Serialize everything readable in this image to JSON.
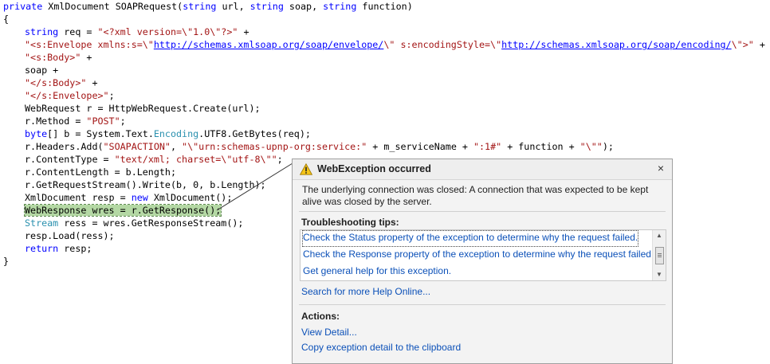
{
  "code": {
    "l1": {
      "k1": "private",
      "t1": " XmlDocument SOAPRequest(",
      "k2": "string",
      "t2": " url, ",
      "k3": "string",
      "t3": " soap, ",
      "k4": "string",
      "t4": " function)"
    },
    "l2": "{",
    "l3": {
      "k1": "string",
      "t1": " req = ",
      "s1": "\"<?xml version=\\\"1.0\\\"?>\"",
      "t2": " +"
    },
    "l4": {
      "s1": "\"<s:Envelope xmlns:s=\\\"",
      "u1": "http://schemas.xmlsoap.org/soap/envelope/",
      "s2": "\\\" s:encodingStyle=\\\"",
      "u2": "http://schemas.xmlsoap.org/soap/encoding/",
      "s3": "\\\">\"",
      "t1": " +"
    },
    "l5": {
      "s1": "\"<s:Body>\"",
      "t1": " +"
    },
    "l6": "soap +",
    "l7": {
      "s1": "\"</s:Body>\"",
      "t1": " +"
    },
    "l8": {
      "s1": "\"</s:Envelope>\"",
      "t1": ";"
    },
    "l9": "WebRequest r = HttpWebRequest.Create(url);",
    "l10": {
      "t1": "r.Method = ",
      "s1": "\"POST\"",
      "t2": ";"
    },
    "l11": {
      "k1": "byte",
      "t1": "[] b = System.Text.",
      "c1": "Encoding",
      "t2": ".UTF8.GetBytes(req);"
    },
    "l12": {
      "t1": "r.Headers.Add(",
      "s1": "\"SOAPACTION\"",
      "t2": ", ",
      "s2": "\"\\\"urn:schemas-upnp-org:service:\"",
      "t3": " + m_serviceName + ",
      "s3": "\":1#\"",
      "t4": " + function + ",
      "s4": "\"\\\"\"",
      "t5": ");"
    },
    "l13": {
      "t1": "r.ContentType = ",
      "s1": "\"text/xml; charset=\\\"utf-8\\\"\"",
      "t2": ";"
    },
    "l14": "r.ContentLength = b.Length;",
    "l15": "r.GetRequestStream().Write(b, 0, b.Length);",
    "l16": {
      "t1": "XmlDocument resp = ",
      "k1": "new",
      "t2": " XmlDocument();"
    },
    "l17": "WebResponse wres = r.GetResponse();",
    "l18": {
      "c1": "Stream",
      "t1": " ress = wres.GetResponseStream();"
    },
    "l19": "resp.Load(ress);",
    "l20": {
      "k1": "return",
      "t1": " resp;"
    },
    "l21": "}"
  },
  "dialog": {
    "icon": "warning-icon",
    "title": "WebException occurred",
    "close": "×",
    "message": "The underlying connection was closed: A connection that was expected to be kept alive was closed by the server.",
    "tips_heading": "Troubleshooting tips:",
    "tips": [
      "Check the Status property of the exception to determine why the request failed.",
      "Check the Response property of the exception to determine why the request failed.",
      "Get general help for this exception."
    ],
    "search_link": "Search for more Help Online...",
    "actions_heading": "Actions:",
    "actions": [
      "View Detail...",
      "Copy exception detail to the clipboard"
    ]
  },
  "colors": {
    "keyword": "#0000ff",
    "string": "#a31515",
    "type": "#2b91af",
    "highlight": "#b4d8a4",
    "link": "#0b50b8"
  }
}
